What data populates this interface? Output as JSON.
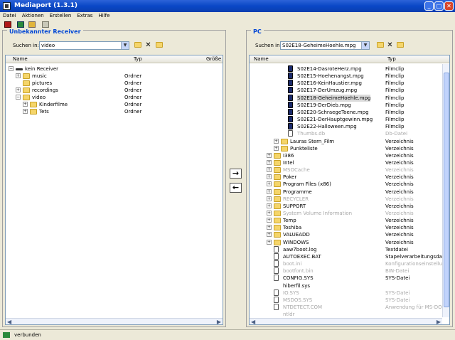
{
  "app": {
    "title": "Mediaport (1.3.1)",
    "window_buttons": [
      "_",
      "□",
      "✕"
    ]
  },
  "menu": [
    "Datei",
    "Aktionen",
    "Erstellen",
    "Extras",
    "Hilfe"
  ],
  "toolbar": [
    "device-icon",
    "import-icon",
    "export-icon",
    "settings-icon"
  ],
  "left": {
    "title": "Unbekannter Receiver",
    "search_label": "Suchen in:",
    "search_value": "video",
    "cols": {
      "name": "Name",
      "type": "Typ",
      "size": "Größe"
    },
    "rows": [
      {
        "name": "kein Receiver",
        "type": "",
        "lvl": 0,
        "exp": "−",
        "icon": "device"
      },
      {
        "name": "music",
        "type": "Ordner",
        "lvl": 1,
        "exp": "+",
        "icon": "folder"
      },
      {
        "name": "pictures",
        "type": "Ordner",
        "lvl": 1,
        "exp": "",
        "icon": "folder"
      },
      {
        "name": "recordings",
        "type": "Ordner",
        "lvl": 1,
        "exp": "+",
        "icon": "folder"
      },
      {
        "name": "video",
        "type": "Ordner",
        "lvl": 1,
        "exp": "−",
        "icon": "folder"
      },
      {
        "name": "Kinderfilme",
        "type": "Ordner",
        "lvl": 2,
        "exp": "+",
        "icon": "folder"
      },
      {
        "name": "Tets",
        "type": "Ordner",
        "lvl": 2,
        "exp": "+",
        "icon": "folder"
      }
    ]
  },
  "right": {
    "title": "PC",
    "search_label": "Suchen in:",
    "search_value": "S02E18-GeheimeHoehle.mpg",
    "cols": {
      "name": "Name",
      "type": "Typ"
    },
    "rows": [
      {
        "name": "S02E14-DasroteHerz.mpg",
        "type": "Filmclip",
        "lvl": 3,
        "icon": "film"
      },
      {
        "name": "S02E15-Hoehenangst.mpg",
        "type": "Filmclip",
        "lvl": 3,
        "icon": "film"
      },
      {
        "name": "S02E16-KeinHaustier.mpg",
        "type": "Filmclip",
        "lvl": 3,
        "icon": "film"
      },
      {
        "name": "S02E17-DerUmzug.mpg",
        "type": "Filmclip",
        "lvl": 3,
        "icon": "film"
      },
      {
        "name": "S02E18-GeheimeHoehle.mpg",
        "type": "Filmclip",
        "lvl": 3,
        "icon": "film",
        "sel": true
      },
      {
        "name": "S02E19-DerDieb.mpg",
        "type": "Filmclip",
        "lvl": 3,
        "icon": "film"
      },
      {
        "name": "S02E20-SchraegeToene.mpg",
        "type": "Filmclip",
        "lvl": 3,
        "icon": "film"
      },
      {
        "name": "S02E21-DerHauptgewinn.mpg",
        "type": "Filmclip",
        "lvl": 3,
        "icon": "film"
      },
      {
        "name": "S02E22-Halloween.mpg",
        "type": "Filmclip",
        "lvl": 3,
        "icon": "film"
      },
      {
        "name": "Thumbs.db",
        "type": "Db-Datei",
        "lvl": 3,
        "icon": "file",
        "dim": true
      },
      {
        "name": "Lauras Stern_Film",
        "type": "Verzeichnis",
        "lvl": 2,
        "exp": "+",
        "icon": "folder"
      },
      {
        "name": "Punkteliste",
        "type": "Verzeichnis",
        "lvl": 2,
        "exp": "+",
        "icon": "folder"
      },
      {
        "name": "I386",
        "type": "Verzeichnis",
        "lvl": 1,
        "exp": "+",
        "icon": "folder"
      },
      {
        "name": "Intel",
        "type": "Verzeichnis",
        "lvl": 1,
        "exp": "+",
        "icon": "folder"
      },
      {
        "name": "MSOCache",
        "type": "Verzeichnis",
        "lvl": 1,
        "exp": "+",
        "icon": "folder",
        "dim": true
      },
      {
        "name": "Poker",
        "type": "Verzeichnis",
        "lvl": 1,
        "exp": "+",
        "icon": "folder"
      },
      {
        "name": "Program Files (x86)",
        "type": "Verzeichnis",
        "lvl": 1,
        "exp": "+",
        "icon": "folder"
      },
      {
        "name": "Programme",
        "type": "Verzeichnis",
        "lvl": 1,
        "exp": "+",
        "icon": "folder"
      },
      {
        "name": "RECYCLER",
        "type": "Verzeichnis",
        "lvl": 1,
        "exp": "+",
        "icon": "folder",
        "dim": true
      },
      {
        "name": "SUPPORT",
        "type": "Verzeichnis",
        "lvl": 1,
        "exp": "+",
        "icon": "folder"
      },
      {
        "name": "System Volume Information",
        "type": "Verzeichnis",
        "lvl": 1,
        "exp": "+",
        "icon": "folder",
        "dim": true
      },
      {
        "name": "Temp",
        "type": "Verzeichnis",
        "lvl": 1,
        "exp": "+",
        "icon": "folder"
      },
      {
        "name": "Toshiba",
        "type": "Verzeichnis",
        "lvl": 1,
        "exp": "+",
        "icon": "folder"
      },
      {
        "name": "VALUEADD",
        "type": "Verzeichnis",
        "lvl": 1,
        "exp": "+",
        "icon": "folder"
      },
      {
        "name": "WINDOWS",
        "type": "Verzeichnis",
        "lvl": 1,
        "exp": "+",
        "icon": "folder"
      },
      {
        "name": "aaw7boot.log",
        "type": "Textdatei",
        "lvl": 1,
        "icon": "file"
      },
      {
        "name": "AUTOEXEC.BAT",
        "type": "Stapelverarbeitungsdatei für",
        "lvl": 1,
        "icon": "file"
      },
      {
        "name": "boot.ini",
        "type": "Konfigurationseinstellungen",
        "lvl": 1,
        "icon": "file",
        "dim": true
      },
      {
        "name": "bootfont.bin",
        "type": "BIN-Datei",
        "lvl": 1,
        "icon": "file",
        "dim": true
      },
      {
        "name": "CONFIG.SYS",
        "type": "SYS-Datei",
        "lvl": 1,
        "icon": "file"
      },
      {
        "name": "hiberfil.sys",
        "type": "",
        "lvl": 1,
        "icon": "none"
      },
      {
        "name": "IO.SYS",
        "type": "SYS-Datei",
        "lvl": 1,
        "icon": "file",
        "dim": true
      },
      {
        "name": "MSDOS.SYS",
        "type": "SYS-Datei",
        "lvl": 1,
        "icon": "file",
        "dim": true
      },
      {
        "name": "NTDETECT.COM",
        "type": "Anwendung für MS-DOS",
        "lvl": 1,
        "icon": "file",
        "dim": true
      },
      {
        "name": "ntldr",
        "type": "",
        "lvl": 1,
        "icon": "none",
        "dim": true
      }
    ]
  },
  "transfer": {
    "to_pc": "→",
    "to_receiver": "←"
  },
  "status": {
    "text": "verbunden"
  }
}
